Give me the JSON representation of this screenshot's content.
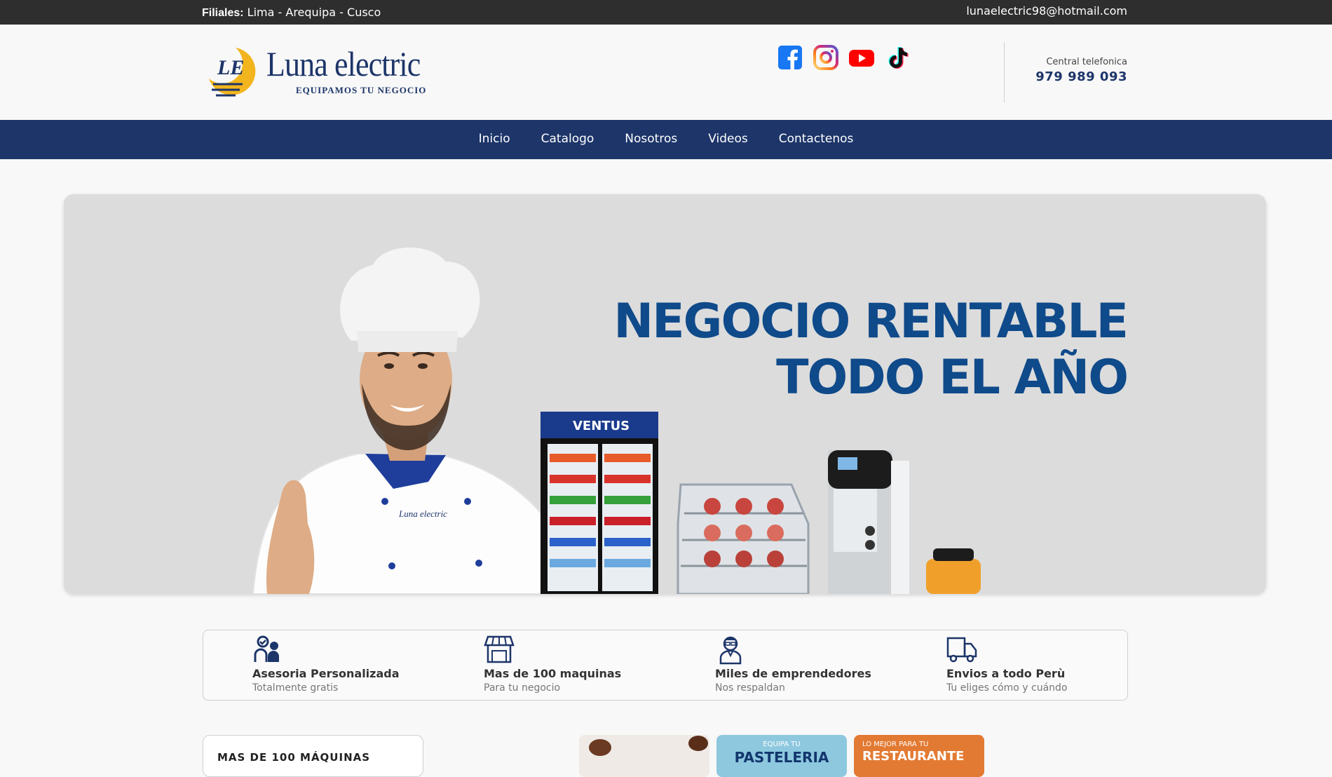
{
  "topbar": {
    "filiales_label": "Filiales:",
    "filiales_value": "Lima - Arequipa - Cusco",
    "email": "lunaelectric98@hotmail.com"
  },
  "header": {
    "logo_name": "Luna electric",
    "logo_tagline": "EQUIPAMOS TU NEGOCIO",
    "socials": [
      "facebook-icon",
      "instagram-icon",
      "youtube-icon",
      "tiktok-icon"
    ],
    "phone_label": "Central telefonica",
    "phone": "979 989 093"
  },
  "nav": {
    "items": [
      "Inicio",
      "Catalogo",
      "Nosotros",
      "Videos",
      "Contactenos"
    ]
  },
  "hero": {
    "line1": "NEGOCIO RENTABLE",
    "line2": "TODO EL AÑO",
    "fridge_brand": "VENTUS",
    "uniform_brand": "Luna electric"
  },
  "features": [
    {
      "icon": "advisor-icon",
      "title": "Asesoria Personalizada",
      "subtitle": "Totalmente gratis"
    },
    {
      "icon": "store-icon",
      "title": "Mas de 100 maquinas",
      "subtitle": "Para tu negocio"
    },
    {
      "icon": "entrepreneur-icon",
      "title": "Miles de emprendedores",
      "subtitle": "Nos respaldan"
    },
    {
      "icon": "truck-icon",
      "title": "Envios a todo Perù",
      "subtitle": "Tu eliges cómo y cuándo"
    }
  ],
  "bottom": {
    "card_title": "MAS DE 100 MÁQUINAS",
    "promos": [
      {
        "tag": "",
        "title": ""
      },
      {
        "tag": "EQUIPA TU",
        "title": "PASTELERIA"
      },
      {
        "tag": "LO MEJOR PARA TU",
        "title": "RESTAURANTE"
      }
    ]
  },
  "colors": {
    "brand_navy": "#1d3569",
    "headline_blue": "#0f4a8a",
    "logo_gold": "#f2b51d",
    "topbar": "#2e2e2e"
  }
}
